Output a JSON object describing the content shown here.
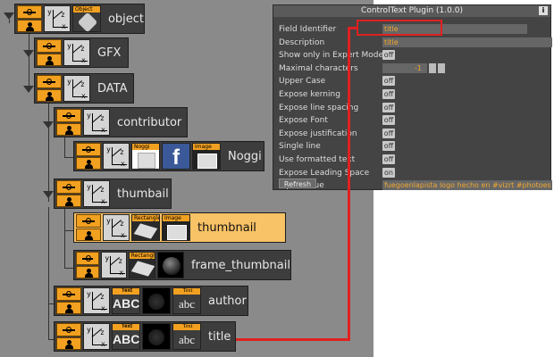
{
  "tree": {
    "nodes": [
      {
        "id": "object",
        "label": "object",
        "thumbs": [
          {
            "tag": "Object",
            "kind": "object"
          }
        ]
      },
      {
        "id": "gfx",
        "label": "GFX",
        "thumbs": []
      },
      {
        "id": "data",
        "label": "DATA",
        "thumbs": []
      },
      {
        "id": "contributor",
        "label": "contributor",
        "thumbs": []
      },
      {
        "id": "noggi",
        "label": "Noggi",
        "thumbs": [
          {
            "tag": "Noggi",
            "kind": "noggi"
          },
          {
            "tag": "",
            "kind": "facebook",
            "text": "f"
          },
          {
            "tag": "Image",
            "kind": "image"
          }
        ]
      },
      {
        "id": "thumbail",
        "label": "thumbail",
        "thumbs": []
      },
      {
        "id": "thumbnail",
        "label": "thumbnail",
        "selected": true,
        "thumbs": [
          {
            "tag": "Rectangle",
            "kind": "rect"
          },
          {
            "tag": "Image",
            "kind": "image"
          }
        ]
      },
      {
        "id": "frame_thumbnail",
        "label": "frame_thumbnail",
        "thumbs": [
          {
            "tag": "Rectangle",
            "kind": "rect"
          },
          {
            "tag": "",
            "kind": "sphere"
          }
        ]
      },
      {
        "id": "author",
        "label": "author",
        "thumbs": [
          {
            "tag": "Text",
            "kind": "abc",
            "text": "ABC"
          },
          {
            "tag": "",
            "kind": "dark"
          },
          {
            "tag": "Text",
            "kind": "abc2",
            "text": "abc"
          }
        ]
      },
      {
        "id": "title",
        "label": "title",
        "thumbs": [
          {
            "tag": "Text",
            "kind": "abc",
            "text": "ABC"
          },
          {
            "tag": "",
            "kind": "dark"
          },
          {
            "tag": "Text",
            "kind": "abc2",
            "text": "abc"
          }
        ]
      }
    ],
    "axis_labels": {
      "y": "y",
      "z": "z",
      "x": "x"
    }
  },
  "panel": {
    "title": "ControlText Plugin (1.0.0)",
    "info_label": "i",
    "rows": [
      {
        "key": "Field Identifier",
        "type": "text",
        "value": "title"
      },
      {
        "key": "Description",
        "type": "text",
        "value": "title"
      },
      {
        "key": "Show only in Expert Mode",
        "type": "toggle",
        "value": "off"
      },
      {
        "key": "Maximal characters",
        "type": "number",
        "value": "-1"
      },
      {
        "key": "Upper Case",
        "type": "toggle",
        "value": "off"
      },
      {
        "key": "Expose kerning",
        "type": "toggle",
        "value": "off"
      },
      {
        "key": "Expose line spacing",
        "type": "toggle",
        "value": "off"
      },
      {
        "key": "Expose Font",
        "type": "toggle",
        "value": "off"
      },
      {
        "key": "Expose justification",
        "type": "toggle",
        "value": "off"
      },
      {
        "key": "Single line",
        "type": "toggle",
        "value": "off"
      },
      {
        "key": "Use formatted text",
        "type": "toggle",
        "value": "off"
      },
      {
        "key": "Expose Leading Space",
        "type": "toggle",
        "value": "on"
      },
      {
        "key": "Input value",
        "type": "text",
        "value": "fuegoenlapista logo hecho en #vizrt #photoes"
      }
    ],
    "refresh_label": "Refresh"
  },
  "colors": {
    "highlight": "#e02020",
    "selected_node": "#f8c266",
    "value_text": "#f0a830"
  }
}
